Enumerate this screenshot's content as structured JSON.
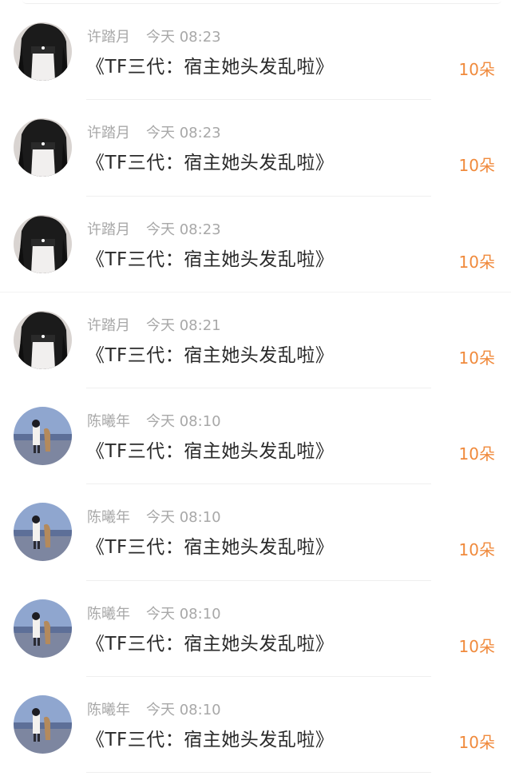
{
  "messages": [
    {
      "sender": "许踏月",
      "time": "今天 08:23",
      "text": "《TF三代：宿主她头发乱啦》",
      "amount": "10朵",
      "avatar": "girl-dark-hair-avatar"
    },
    {
      "sender": "许踏月",
      "time": "今天 08:23",
      "text": "《TF三代：宿主她头发乱啦》",
      "amount": "10朵",
      "avatar": "girl-dark-hair-avatar"
    },
    {
      "sender": "许踏月",
      "time": "今天 08:23",
      "text": "《TF三代：宿主她头发乱啦》",
      "amount": "10朵",
      "avatar": "girl-dark-hair-avatar"
    },
    {
      "sender": "许踏月",
      "time": "今天 08:21",
      "text": "《TF三代：宿主她头发乱啦》",
      "amount": "10朵",
      "avatar": "girl-dark-hair-avatar"
    },
    {
      "sender": "陈曦年",
      "time": "今天 08:10",
      "text": "《TF三代：宿主她头发乱啦》",
      "amount": "10朵",
      "avatar": "seaside-girl-avatar"
    },
    {
      "sender": "陈曦年",
      "time": "今天 08:10",
      "text": "《TF三代：宿主她头发乱啦》",
      "amount": "10朵",
      "avatar": "seaside-girl-avatar"
    },
    {
      "sender": "陈曦年",
      "time": "今天 08:10",
      "text": "《TF三代：宿主她头发乱啦》",
      "amount": "10朵",
      "avatar": "seaside-girl-avatar"
    },
    {
      "sender": "陈曦年",
      "time": "今天 08:10",
      "text": "《TF三代：宿主她头发乱啦》",
      "amount": "10朵",
      "avatar": "seaside-girl-avatar"
    }
  ],
  "colors": {
    "amount": "#f08a3c",
    "meta": "#a8a8a8",
    "text": "#2a2a2a",
    "divider": "#efefef"
  }
}
